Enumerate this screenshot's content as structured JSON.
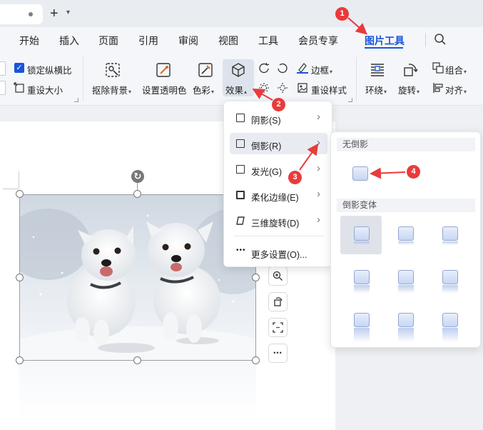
{
  "tabs": {
    "add_tab": "+",
    "tab_chevron": "⌄"
  },
  "menu": {
    "items": [
      "开始",
      "插入",
      "页面",
      "引用",
      "审阅",
      "视图",
      "工具",
      "会员专享",
      "图片工具"
    ],
    "active": "图片工具"
  },
  "ribbon": {
    "lock_aspect": "锁定纵横比",
    "lock_checked": true,
    "reset_size": "重设大小",
    "remove_bg": "抠除背景",
    "set_transparent": "设置透明色",
    "color": "色彩",
    "effects": "效果",
    "border": "边框",
    "reset_style": "重设样式",
    "wrap": "环绕",
    "rotate": "旋转",
    "group": "组合",
    "align": "对齐"
  },
  "effects_menu": {
    "items": [
      {
        "label": "阴影(S)",
        "icon": "shadow-icon",
        "has_submenu": true
      },
      {
        "label": "倒影(R)",
        "icon": "reflection-icon",
        "has_submenu": true,
        "highlighted": true
      },
      {
        "label": "发光(G)",
        "icon": "glow-icon",
        "has_submenu": true
      },
      {
        "label": "柔化边缘(E)",
        "icon": "soft-edges-icon",
        "has_submenu": true
      },
      {
        "label": "三维旋转(D)",
        "icon": "3d-rotation-icon",
        "has_submenu": true
      }
    ],
    "more_settings": "更多设置(O)..."
  },
  "reflection_submenu": {
    "no_reflection_header": "无倒影",
    "variants_header": "倒影变体",
    "selected_variant": 1,
    "variants_count": 9
  },
  "side_toolbar": [
    "zoom-icon",
    "crop-rotate-icon",
    "scan-icon",
    "more-icon"
  ],
  "more_glyph": "•••",
  "annotations": {
    "badges": [
      "1",
      "2",
      "3",
      "4"
    ],
    "color": "#e93b3b"
  },
  "colors": {
    "accent": "#1a56db",
    "ribbon_bg": "#f4f6f9",
    "canvas_bg": "#eef0f3"
  }
}
